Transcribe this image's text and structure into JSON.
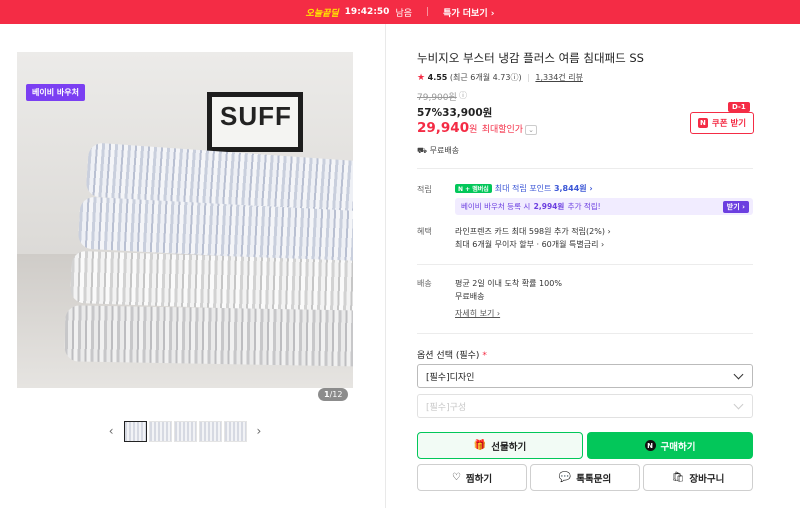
{
  "topbar": {
    "deal_label": "오늘끝딜",
    "time_remaining": "19:42:50",
    "time_suffix": "남음",
    "more_label": "특가 더보기 ›"
  },
  "gallery": {
    "badge": "베이비 바우처",
    "image_text": "SUFF",
    "counter_current": "1",
    "counter_total": "/12",
    "thumbnails": [
      "thumb-1",
      "thumb-2",
      "thumb-3",
      "thumb-4",
      "thumb-5"
    ]
  },
  "product": {
    "title": "누비지오 부스터 냉감 플러스 여름 침대패드 SS",
    "rating": "4.55",
    "rating_detail": "(최근 6개월 4.73",
    "rating_detail_end": ")",
    "review_count": "1,334건 리뷰",
    "original_price": "79,900원",
    "discount_rate": "57%",
    "sale_price": "33,900원",
    "best_price": "29,940",
    "best_price_unit": "원",
    "best_label": "최대할인가",
    "coupon_label": "쿠폰 받기",
    "coupon_dday": "D-1",
    "free_shipping": "무료배송"
  },
  "benefits": {
    "point_label": "적립",
    "npay_badge": "N + 멤버십",
    "point_text": "최대 적립 포인트",
    "point_value": "3,844원 ›",
    "baby_text_pre": "베이비 바우처 등록 시",
    "baby_amount": "2,994원",
    "baby_text_post": "추가 적립!",
    "baby_button": "받기 ›",
    "benefit_label": "혜택",
    "benefit_line1": "라인프렌즈 카드 최대 598원 추가 적립(2%) ›",
    "benefit_line2": "최대 6개월 무이자 할부 · 60개월 특별금리 ›",
    "shipping_label": "배송",
    "shipping_line1": "평균 2일 이내 도착 확률 100%",
    "shipping_line2": "무료배송",
    "detail_link": "자세히 보기 ›"
  },
  "options": {
    "title": "옵션 선택 (필수)",
    "required_mark": "*",
    "select1": "[필수]디자인",
    "select2": "[필수]구성"
  },
  "actions": {
    "gift": "선물하기",
    "buy": "구매하기",
    "wish": "찜하기",
    "talk": "톡톡문의",
    "cart": "장바구니"
  },
  "colors": {
    "brand_red": "#f42c45",
    "naver_green": "#03c75a",
    "voucher_purple": "#7b3ff2"
  }
}
